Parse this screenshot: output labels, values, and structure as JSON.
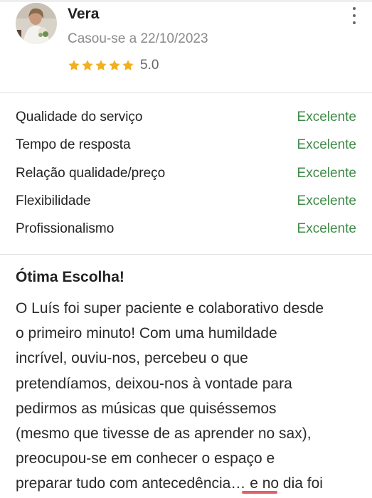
{
  "reviewer": {
    "name": "Vera",
    "married": "Casou-se a 22/10/2023",
    "stars": 5,
    "rating": "5.0"
  },
  "criteria": [
    {
      "label": "Qualidade do serviço",
      "value": "Excelente"
    },
    {
      "label": "Tempo de resposta",
      "value": "Excelente"
    },
    {
      "label": "Relação qualidade/preço",
      "value": "Excelente"
    },
    {
      "label": "Flexibilidade",
      "value": "Excelente"
    },
    {
      "label": "Profissionalismo",
      "value": "Excelente"
    }
  ],
  "review": {
    "title": "Ótima Escolha!",
    "lines": [
      "O Luís foi super paciente e colaborativo desde",
      "o primeiro minuto! Com uma humildade",
      "incrível, ouviu-nos, percebeu o que",
      "pretendíamos, deixou-nos à vontade para",
      "pedirmos as músicas que quiséssemos",
      "(mesmo que tivesse de as aprender no sax),",
      "preocupou-se em conhecer o espaço e",
      "preparar tudo com antecedência… e no dia foi"
    ]
  },
  "colors": {
    "excellent": "#3f8a45",
    "star": "#f2b01e",
    "accent": "#e0616a"
  },
  "icons": {
    "more": "more-vertical-icon",
    "star": "star-icon"
  }
}
